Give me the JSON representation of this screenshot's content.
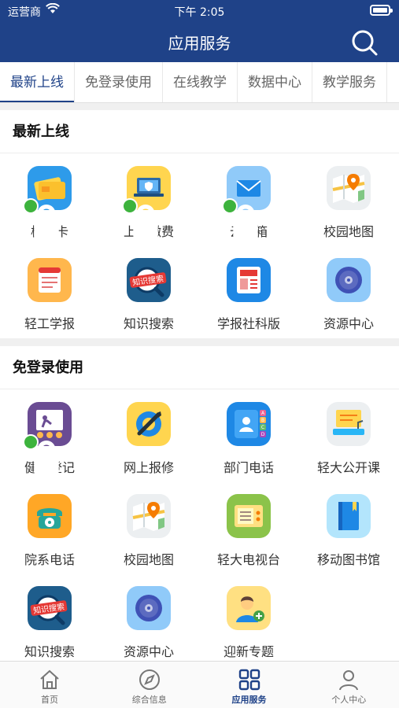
{
  "status_bar": {
    "carrier": "运营商",
    "time": "下午 2:05"
  },
  "header": {
    "title": "应用服务"
  },
  "tabs": [
    {
      "label": "最新上线",
      "active": true
    },
    {
      "label": "免登录使用",
      "active": false
    },
    {
      "label": "在线教学",
      "active": false
    },
    {
      "label": "数据中心",
      "active": false
    },
    {
      "label": "教学服务",
      "active": false
    }
  ],
  "sections": [
    {
      "title": "最新上线",
      "apps": [
        {
          "label": "校园卡",
          "icon": "card-icon",
          "locked": true
        },
        {
          "label": "上网缴费",
          "icon": "laptop-shield-icon",
          "locked": true
        },
        {
          "label": "云邮箱",
          "icon": "mail-icon",
          "locked": true
        },
        {
          "label": "校园地图",
          "icon": "map-icon",
          "locked": false
        },
        {
          "label": "轻工学报",
          "icon": "newspaper-icon",
          "locked": false
        },
        {
          "label": "知识搜索",
          "icon": "knowledge-search-icon",
          "locked": false,
          "badge": "知识搜索"
        },
        {
          "label": "学报社科版",
          "icon": "journal-icon",
          "locked": false
        },
        {
          "label": "资源中心",
          "icon": "disc-icon",
          "locked": false
        }
      ]
    },
    {
      "title": "免登录使用",
      "apps": [
        {
          "label": "健康登记",
          "icon": "health-register-icon",
          "locked": true
        },
        {
          "label": "网上报修",
          "icon": "repair-icon",
          "locked": false
        },
        {
          "label": "部门电话",
          "icon": "contacts-icon",
          "locked": false,
          "tabs": [
            "A",
            "B",
            "C",
            "D"
          ]
        },
        {
          "label": "轻大公开课",
          "icon": "open-course-icon",
          "locked": false
        },
        {
          "label": "院系电话",
          "icon": "telephone-icon",
          "locked": false
        },
        {
          "label": "校园地图",
          "icon": "map-icon",
          "locked": false
        },
        {
          "label": "轻大电视台",
          "icon": "tv-icon",
          "locked": false
        },
        {
          "label": "移动图书馆",
          "icon": "book-icon",
          "locked": false
        },
        {
          "label": "知识搜索",
          "icon": "knowledge-search-icon",
          "locked": false,
          "badge": "知识搜索"
        },
        {
          "label": "资源中心",
          "icon": "disc-icon",
          "locked": false
        },
        {
          "label": "迎新专题",
          "icon": "welcome-icon",
          "locked": false
        }
      ]
    }
  ],
  "bottom_nav": [
    {
      "label": "首页",
      "icon": "home-icon",
      "active": false
    },
    {
      "label": "综合信息",
      "icon": "compass-icon",
      "active": false
    },
    {
      "label": "应用服务",
      "icon": "grid-icon",
      "active": true
    },
    {
      "label": "个人中心",
      "icon": "person-icon",
      "active": false
    }
  ],
  "colors": {
    "primary": "#1f4288",
    "lock": "#3db33d",
    "tab_active": "#1f4288"
  }
}
